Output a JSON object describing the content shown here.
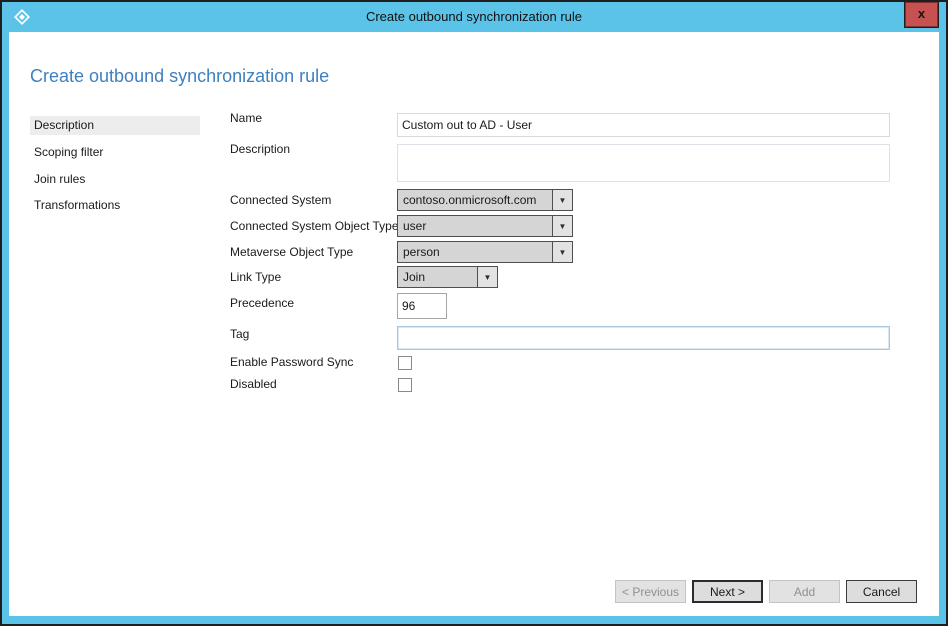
{
  "window": {
    "title": "Create outbound synchronization rule",
    "close_label": "x",
    "icon": "sync-rules-diamond-icon",
    "titlebar_color": "#5BC3E8",
    "close_color": "#C75050"
  },
  "heading": "Create outbound synchronization rule",
  "heading_color": "#3E80C0",
  "sidebar": {
    "items": [
      {
        "label": "Description",
        "selected": true
      },
      {
        "label": "Scoping filter",
        "selected": false
      },
      {
        "label": "Join rules",
        "selected": false
      },
      {
        "label": "Transformations",
        "selected": false
      }
    ]
  },
  "form": {
    "name": {
      "label": "Name",
      "value": "Custom out to AD - User"
    },
    "description": {
      "label": "Description",
      "value": ""
    },
    "connected_system": {
      "label": "Connected System",
      "value": "contoso.onmicrosoft.com",
      "type": "dropdown"
    },
    "cs_object_type": {
      "label": "Connected System Object Type",
      "value": "user",
      "type": "dropdown"
    },
    "metaverse_object_type": {
      "label": "Metaverse Object Type",
      "value": "person",
      "type": "dropdown"
    },
    "link_type": {
      "label": "Link Type",
      "value": "Join",
      "type": "dropdown"
    },
    "precedence": {
      "label": "Precedence",
      "value": "96"
    },
    "tag": {
      "label": "Tag",
      "value": ""
    },
    "enable_password_sync": {
      "label": "Enable Password Sync",
      "checked": false
    },
    "disabled": {
      "label": "Disabled",
      "checked": false
    },
    "dropdown_arrow": "▼"
  },
  "buttons": [
    {
      "label": "< Previous",
      "enabled": false
    },
    {
      "label": "Next >",
      "enabled": true
    },
    {
      "label": "Add",
      "enabled": false
    },
    {
      "label": "Cancel",
      "enabled": true
    }
  ]
}
